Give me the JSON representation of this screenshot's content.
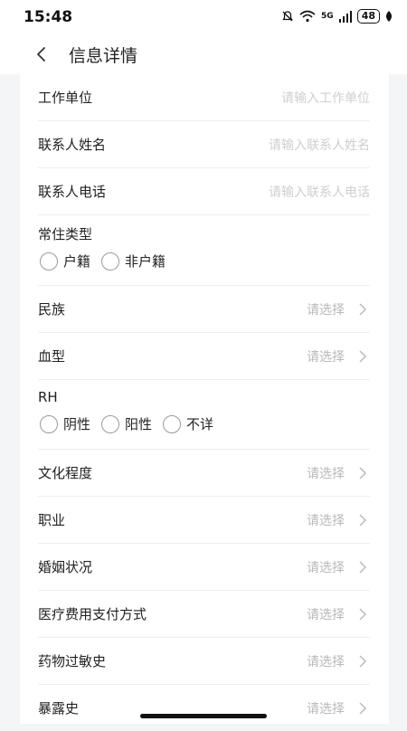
{
  "status": {
    "time": "15:48",
    "battery": "48",
    "network": "5G"
  },
  "nav": {
    "title": "信息详情"
  },
  "fields": {
    "work_unit": {
      "label": "工作单位",
      "placeholder": "请输入工作单位"
    },
    "contact_name": {
      "label": "联系人姓名",
      "placeholder": "请输入联系人姓名"
    },
    "contact_phone": {
      "label": "联系人电话",
      "placeholder": "请输入联系人电话"
    }
  },
  "residence": {
    "label": "常住类型",
    "options": [
      "户籍",
      "非户籍"
    ]
  },
  "selects": {
    "ethnicity": {
      "label": "民族",
      "value": "请选择"
    },
    "blood_type": {
      "label": "血型",
      "value": "请选择"
    },
    "education": {
      "label": "文化程度",
      "value": "请选择"
    },
    "occupation": {
      "label": "职业",
      "value": "请选择"
    },
    "marital": {
      "label": "婚姻状况",
      "value": "请选择"
    },
    "payment": {
      "label": "医疗费用支付方式",
      "value": "请选择"
    },
    "allergy": {
      "label": "药物过敏史",
      "value": "请选择"
    },
    "exposure": {
      "label": "暴露史",
      "value": "请选择"
    }
  },
  "rh": {
    "label": "RH",
    "options": [
      "阴性",
      "阳性",
      "不详"
    ]
  },
  "colors": {
    "background": "#f4f5f7",
    "card": "#ffffff",
    "placeholder": "#cfcfcf",
    "divider": "#eeeeee"
  }
}
